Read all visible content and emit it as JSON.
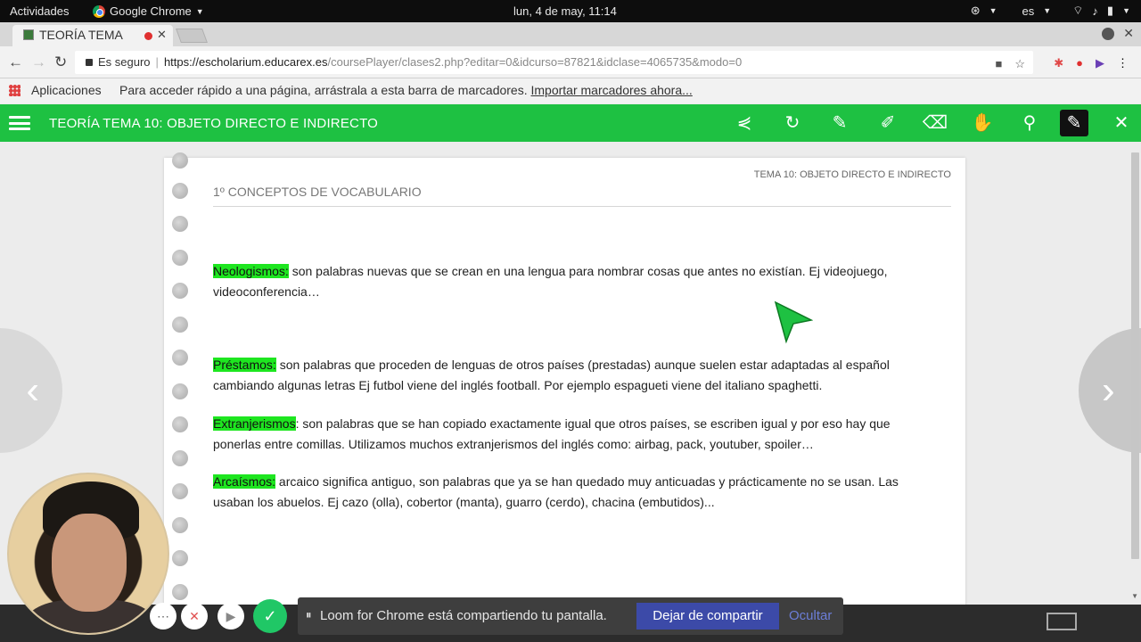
{
  "system_bar": {
    "activities": "Actividades",
    "app_name": "Google Chrome",
    "clock": "lun,  4 de may, 11:14",
    "language": "es"
  },
  "browser": {
    "tab_title": "TEORÍA TEMA",
    "url_security": "Es seguro",
    "url_host": "https://escholarium.educarex.es",
    "url_path": "/coursePlayer/clases2.php?editar=0&idcurso=87821&idclase=4065735&modo=0",
    "bookmarks": {
      "apps_label": "Aplicaciones",
      "hint_text": "Para acceder rápido a una página, arrástrala a esta barra de marcadores.",
      "import_link": "Importar marcadores ahora..."
    }
  },
  "app_header": {
    "title": "TEORÍA TEMA 10: OBJETO DIRECTO E INDIRECTO",
    "accent_color": "#1ec142",
    "tools": [
      "share-icon",
      "refresh-icon",
      "pencil-icon",
      "marker-icon",
      "eraser-icon",
      "hand-icon",
      "search-icon",
      "pen-active-icon",
      "close-icon"
    ]
  },
  "sheet": {
    "breadcrumb": "TEMA 10: OBJETO DIRECTO E INDIRECTO",
    "heading": "1º CONCEPTOS DE VOCABULARIO",
    "highlight_color": "#1ee620",
    "items": [
      {
        "term": "Neologismos:",
        "text": " son palabras nuevas que se crean en una lengua para nombrar cosas que antes no existían. Ej videojuego, videoconferencia…"
      },
      {
        "term": "Préstamos:",
        "text": " son palabras que proceden de lenguas de otros países (prestadas) aunque suelen estar adaptadas al español cambiando algunas letras Ej futbol viene del inglés football. Por ejemplo espagueti viene del italiano spaghetti."
      },
      {
        "term": "Extranjerismos",
        "text": ": son palabras que se han copiado exactamente igual que otros países, se escriben igual y por eso hay que ponerlas entre comillas. Utilizamos muchos extranjerismos del inglés como: airbag, pack, youtuber, spoiler…"
      },
      {
        "term": "Arcaísmos:",
        "text": " arcaico significa antiguo, son palabras que ya se han quedado muy anticuadas y prácticamente no se  usan. Las usaban los abuelos. Ej cazo (olla), cobertor (manta), guarro (cerdo), chacina (embutidos)..."
      }
    ]
  },
  "loom": {
    "share_message": "Loom for Chrome está compartiendo tu pantalla.",
    "stop_button": "Dejar de compartir",
    "hide_button": "Ocultar"
  }
}
